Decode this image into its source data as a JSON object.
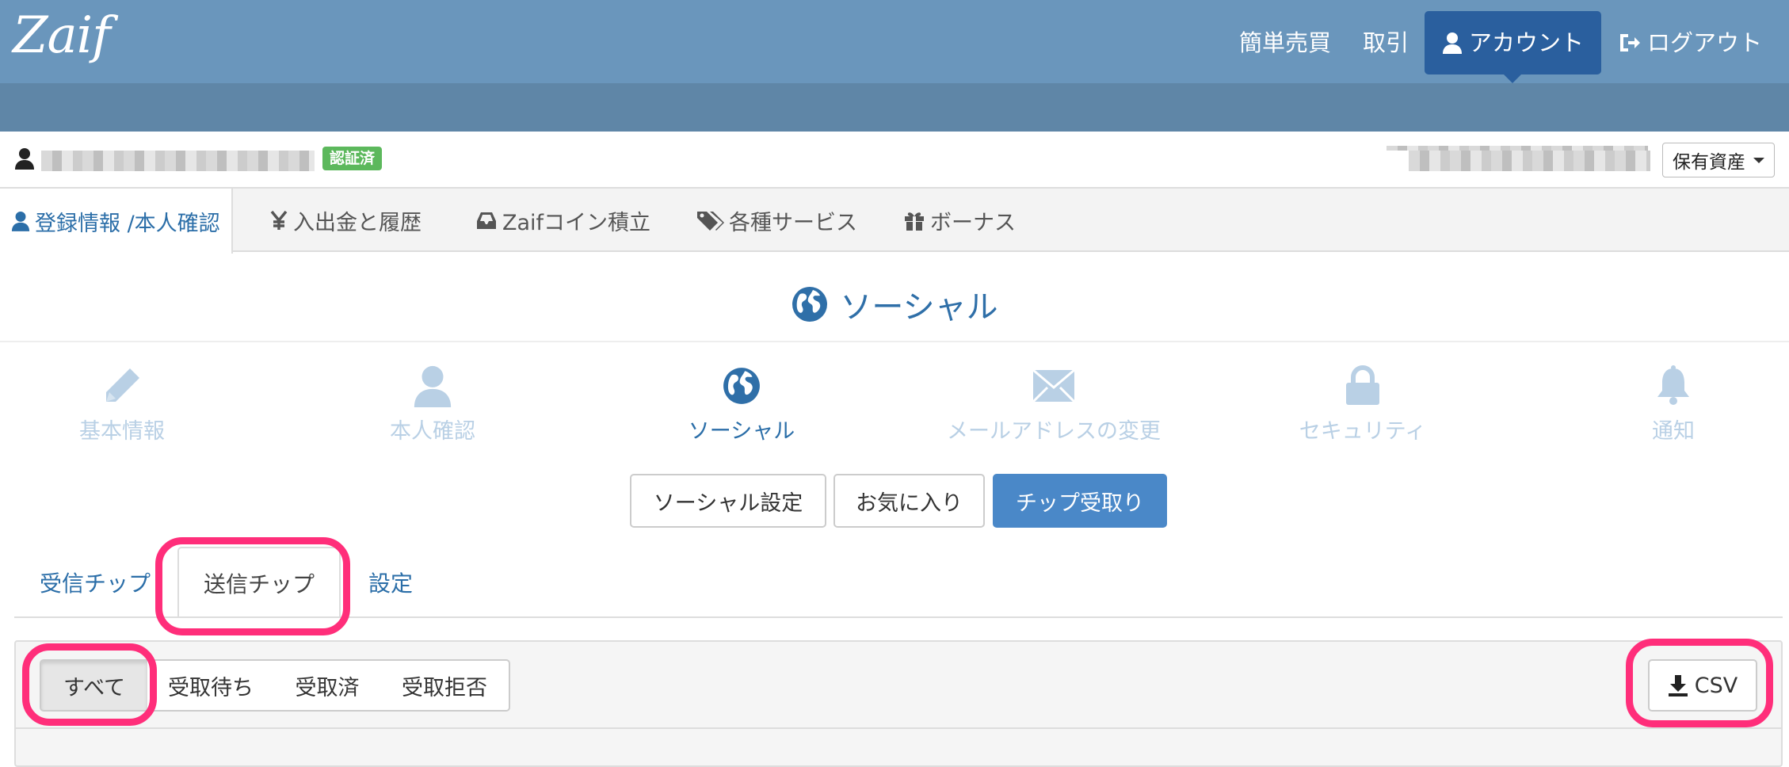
{
  "topnav": {
    "logo": "Zaif",
    "items": [
      {
        "label": "簡単売買"
      },
      {
        "label": "取引"
      },
      {
        "label": "アカウント",
        "active": true
      },
      {
        "label": "ログアウト"
      }
    ]
  },
  "userbar": {
    "badge": "認証済",
    "assets_label": "保有資産"
  },
  "tabs": [
    {
      "label": "登録情報 /本人確認",
      "active": true
    },
    {
      "label": "入出金と履歴"
    },
    {
      "label": "Zaifコイン積立"
    },
    {
      "label": "各種サービス"
    },
    {
      "label": "ボーナス"
    }
  ],
  "section": {
    "title": "ソーシャル"
  },
  "steps": [
    {
      "label": "基本情報",
      "icon": "pencil-icon"
    },
    {
      "label": "本人確認",
      "icon": "user-icon"
    },
    {
      "label": "ソーシャル",
      "icon": "globe-icon",
      "active": true
    },
    {
      "label": "メールアドレスの変更",
      "icon": "envelope-icon"
    },
    {
      "label": "セキュリティ",
      "icon": "lock-icon"
    },
    {
      "label": "通知",
      "icon": "bell-icon"
    }
  ],
  "buttons": {
    "social_settings": "ソーシャル設定",
    "favorites": "お気に入り",
    "tip_receive": "チップ受取り"
  },
  "subtabs": {
    "received": "受信チップ",
    "sent": "送信チップ",
    "settings": "設定"
  },
  "filters": {
    "all": "すべて",
    "pending": "受取待ち",
    "received": "受取済",
    "rejected": "受取拒否"
  },
  "csv_label": "CSV",
  "colors": {
    "header": "#6a96bc",
    "active_nav": "#2a5f9e",
    "primary": "#4a88c8",
    "highlight": "#ff2e7a",
    "verified": "#5cb85c"
  }
}
